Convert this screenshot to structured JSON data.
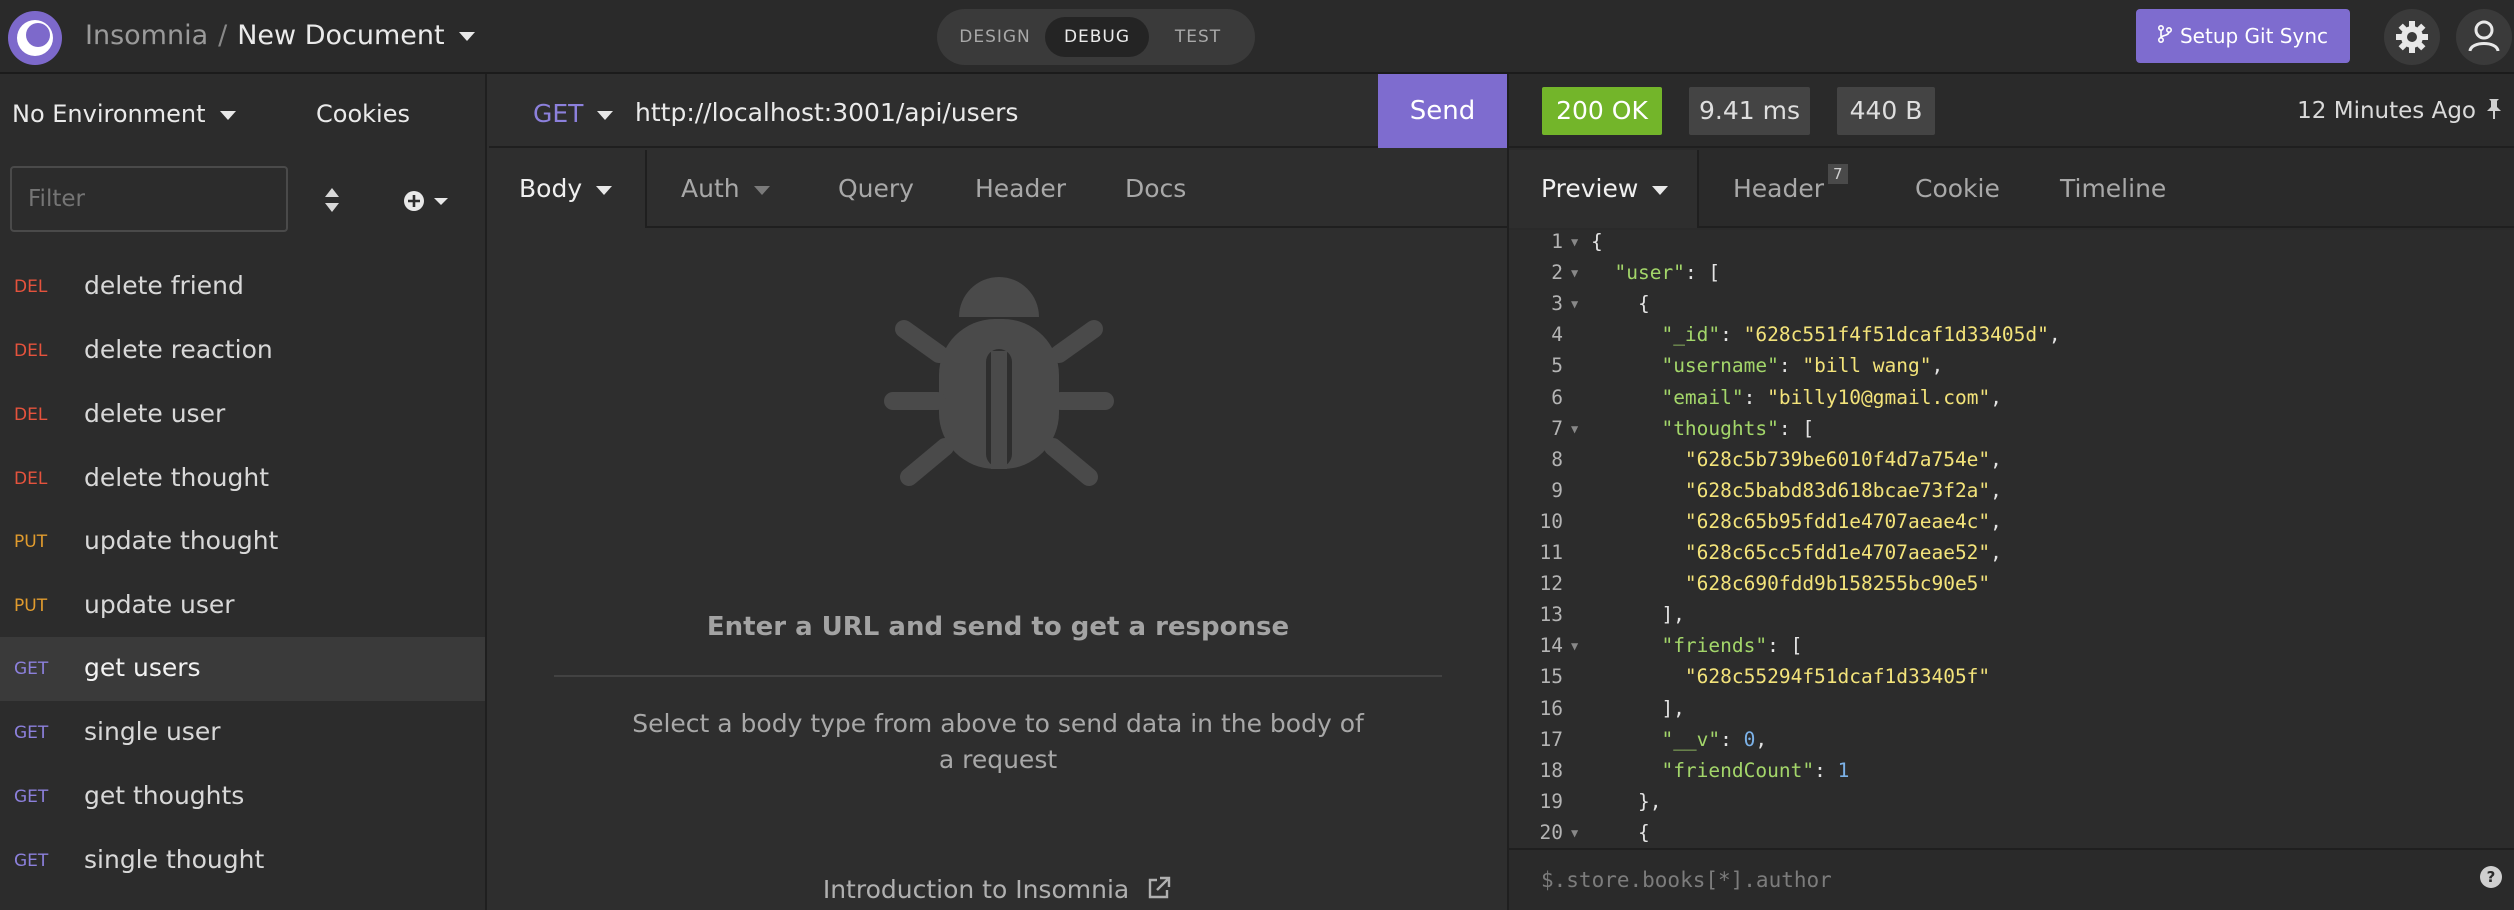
{
  "app": {
    "name": "Insomnia",
    "separator": "/",
    "document": "New Document",
    "brand_color": "#7e6ccf"
  },
  "modes": [
    {
      "label": "DESIGN",
      "active": false
    },
    {
      "label": "DEBUG",
      "active": true
    },
    {
      "label": "TEST",
      "active": false
    }
  ],
  "header": {
    "git_sync_label": "Setup Git Sync",
    "settings_icon": "gear-icon",
    "account_icon": "user-icon"
  },
  "sidebar": {
    "environment": "No Environment",
    "cookies": "Cookies",
    "filter_placeholder": "Filter",
    "requests": [
      {
        "method": "DEL",
        "name": "delete friend",
        "color": "#e5533d",
        "active": false
      },
      {
        "method": "DEL",
        "name": "delete reaction",
        "color": "#e5533d",
        "active": false
      },
      {
        "method": "DEL",
        "name": "delete user",
        "color": "#e5533d",
        "active": false
      },
      {
        "method": "DEL",
        "name": "delete thought",
        "color": "#e5533d",
        "active": false
      },
      {
        "method": "PUT",
        "name": "update thought",
        "color": "#e09b2e",
        "active": false
      },
      {
        "method": "PUT",
        "name": "update user",
        "color": "#e09b2e",
        "active": false
      },
      {
        "method": "GET",
        "name": "get users",
        "color": "#8c80dc",
        "active": true
      },
      {
        "method": "GET",
        "name": "single user",
        "color": "#8c80dc",
        "active": false
      },
      {
        "method": "GET",
        "name": "get thoughts",
        "color": "#8c80dc",
        "active": false
      },
      {
        "method": "GET",
        "name": "single thought",
        "color": "#8c80dc",
        "active": false
      }
    ]
  },
  "request": {
    "method": "GET",
    "url": "http://localhost:3001/api/users",
    "send_label": "Send",
    "tabs": [
      "Body",
      "Auth",
      "Query",
      "Header",
      "Docs"
    ],
    "empty_title": "Enter a URL and send to get a response",
    "empty_text": "Select a body type from above to send data in the body of a request",
    "intro_link": "Introduction to Insomnia"
  },
  "response": {
    "status": "200 OK",
    "time": "9.41 ms",
    "size": "440 B",
    "age": "12 Minutes Ago",
    "status_color": "#73b52a",
    "tabs": [
      "Preview",
      "Header",
      "Cookie",
      "Timeline"
    ],
    "header_count": "7",
    "filter_placeholder": "$.store.books[*].author",
    "help": "?",
    "lines": [
      {
        "n": "1",
        "fold": true,
        "tokens": [
          {
            "t": "p",
            "v": "{"
          }
        ]
      },
      {
        "n": "2",
        "fold": true,
        "tokens": [
          {
            "t": "p",
            "v": "  "
          },
          {
            "t": "k",
            "v": "\"user\""
          },
          {
            "t": "p",
            "v": ": ["
          }
        ]
      },
      {
        "n": "3",
        "fold": true,
        "tokens": [
          {
            "t": "p",
            "v": "    {"
          }
        ]
      },
      {
        "n": "4",
        "fold": false,
        "tokens": [
          {
            "t": "p",
            "v": "      "
          },
          {
            "t": "k",
            "v": "\"_id\""
          },
          {
            "t": "p",
            "v": ": "
          },
          {
            "t": "s",
            "v": "\"628c551f4f51dcaf1d33405d\""
          },
          {
            "t": "p",
            "v": ","
          }
        ]
      },
      {
        "n": "5",
        "fold": false,
        "tokens": [
          {
            "t": "p",
            "v": "      "
          },
          {
            "t": "k",
            "v": "\"username\""
          },
          {
            "t": "p",
            "v": ": "
          },
          {
            "t": "s",
            "v": "\"bill wang\""
          },
          {
            "t": "p",
            "v": ","
          }
        ]
      },
      {
        "n": "6",
        "fold": false,
        "tokens": [
          {
            "t": "p",
            "v": "      "
          },
          {
            "t": "k",
            "v": "\"email\""
          },
          {
            "t": "p",
            "v": ": "
          },
          {
            "t": "s",
            "v": "\"billy10@gmail.com\""
          },
          {
            "t": "p",
            "v": ","
          }
        ]
      },
      {
        "n": "7",
        "fold": true,
        "tokens": [
          {
            "t": "p",
            "v": "      "
          },
          {
            "t": "k",
            "v": "\"thoughts\""
          },
          {
            "t": "p",
            "v": ": ["
          }
        ]
      },
      {
        "n": "8",
        "fold": false,
        "tokens": [
          {
            "t": "p",
            "v": "        "
          },
          {
            "t": "s",
            "v": "\"628c5b739be6010f4d7a754e\""
          },
          {
            "t": "p",
            "v": ","
          }
        ]
      },
      {
        "n": "9",
        "fold": false,
        "tokens": [
          {
            "t": "p",
            "v": "        "
          },
          {
            "t": "s",
            "v": "\"628c5babd83d618bcae73f2a\""
          },
          {
            "t": "p",
            "v": ","
          }
        ]
      },
      {
        "n": "10",
        "fold": false,
        "tokens": [
          {
            "t": "p",
            "v": "        "
          },
          {
            "t": "s",
            "v": "\"628c65b95fdd1e4707aeae4c\""
          },
          {
            "t": "p",
            "v": ","
          }
        ]
      },
      {
        "n": "11",
        "fold": false,
        "tokens": [
          {
            "t": "p",
            "v": "        "
          },
          {
            "t": "s",
            "v": "\"628c65cc5fdd1e4707aeae52\""
          },
          {
            "t": "p",
            "v": ","
          }
        ]
      },
      {
        "n": "12",
        "fold": false,
        "tokens": [
          {
            "t": "p",
            "v": "        "
          },
          {
            "t": "s",
            "v": "\"628c690fdd9b158255bc90e5\""
          }
        ]
      },
      {
        "n": "13",
        "fold": false,
        "tokens": [
          {
            "t": "p",
            "v": "      ],"
          }
        ]
      },
      {
        "n": "14",
        "fold": true,
        "tokens": [
          {
            "t": "p",
            "v": "      "
          },
          {
            "t": "k",
            "v": "\"friends\""
          },
          {
            "t": "p",
            "v": ": ["
          }
        ]
      },
      {
        "n": "15",
        "fold": false,
        "tokens": [
          {
            "t": "p",
            "v": "        "
          },
          {
            "t": "s",
            "v": "\"628c55294f51dcaf1d33405f\""
          }
        ]
      },
      {
        "n": "16",
        "fold": false,
        "tokens": [
          {
            "t": "p",
            "v": "      ],"
          }
        ]
      },
      {
        "n": "17",
        "fold": false,
        "tokens": [
          {
            "t": "p",
            "v": "      "
          },
          {
            "t": "k",
            "v": "\"__v\""
          },
          {
            "t": "p",
            "v": ": "
          },
          {
            "t": "nm",
            "v": "0"
          },
          {
            "t": "p",
            "v": ","
          }
        ]
      },
      {
        "n": "18",
        "fold": false,
        "tokens": [
          {
            "t": "p",
            "v": "      "
          },
          {
            "t": "k",
            "v": "\"friendCount\""
          },
          {
            "t": "p",
            "v": ": "
          },
          {
            "t": "nm",
            "v": "1"
          }
        ]
      },
      {
        "n": "19",
        "fold": false,
        "tokens": [
          {
            "t": "p",
            "v": "    },"
          }
        ]
      },
      {
        "n": "20",
        "fold": true,
        "tokens": [
          {
            "t": "p",
            "v": "    {"
          }
        ]
      }
    ]
  }
}
